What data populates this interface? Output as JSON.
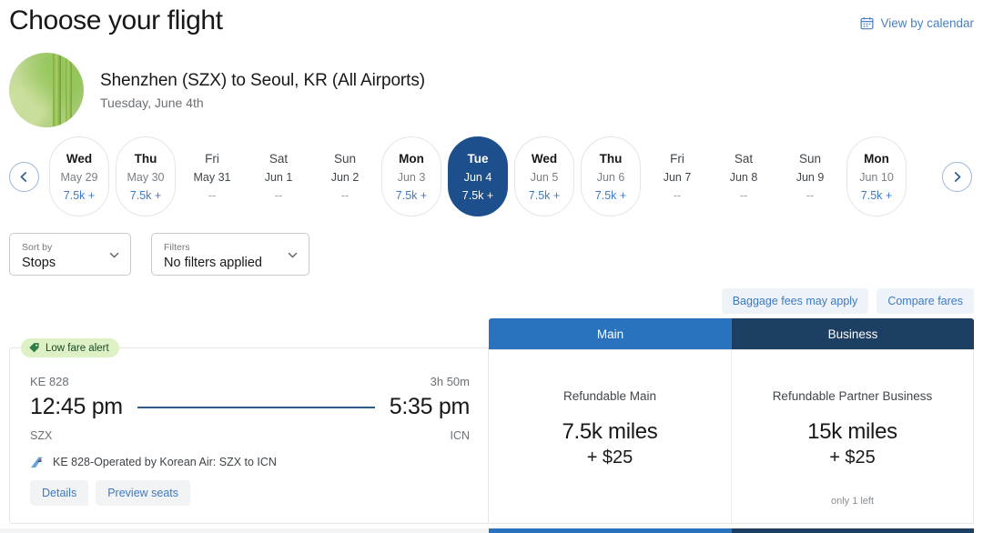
{
  "header": {
    "title": "Choose your flight",
    "view_by_calendar": "View by calendar",
    "calendar_icon": "calendar-icon"
  },
  "route": {
    "title": "Shenzhen (SZX) to Seoul, KR (All Airports)",
    "subtitle": "Tuesday, June 4th"
  },
  "carousel": {
    "prev_label": "chevron-left-icon",
    "next_label": "chevron-right-icon",
    "dates": [
      {
        "dow": "Wed",
        "date": "May 29",
        "price": "7.5k +",
        "state": "avail"
      },
      {
        "dow": "Thu",
        "date": "May 30",
        "price": "7.5k +",
        "state": "avail"
      },
      {
        "dow": "Fri",
        "date": "May 31",
        "price": "--",
        "state": "none"
      },
      {
        "dow": "Sat",
        "date": "Jun 1",
        "price": "--",
        "state": "none"
      },
      {
        "dow": "Sun",
        "date": "Jun 2",
        "price": "--",
        "state": "none"
      },
      {
        "dow": "Mon",
        "date": "Jun 3",
        "price": "7.5k +",
        "state": "avail"
      },
      {
        "dow": "Tue",
        "date": "Jun 4",
        "price": "7.5k +",
        "state": "selected"
      },
      {
        "dow": "Wed",
        "date": "Jun 5",
        "price": "7.5k +",
        "state": "avail"
      },
      {
        "dow": "Thu",
        "date": "Jun 6",
        "price": "7.5k +",
        "state": "avail"
      },
      {
        "dow": "Fri",
        "date": "Jun 7",
        "price": "--",
        "state": "none"
      },
      {
        "dow": "Sat",
        "date": "Jun 8",
        "price": "--",
        "state": "none"
      },
      {
        "dow": "Sun",
        "date": "Jun 9",
        "price": "--",
        "state": "none"
      },
      {
        "dow": "Mon",
        "date": "Jun 10",
        "price": "7.5k +",
        "state": "avail"
      }
    ]
  },
  "controls": {
    "sort": {
      "label": "Sort by",
      "value": "Stops"
    },
    "filters": {
      "label": "Filters",
      "value": "No filters applied"
    }
  },
  "fare_links": {
    "baggage": "Baggage fees may apply",
    "compare": "Compare fares"
  },
  "cabins": {
    "main": "Main",
    "business": "Business"
  },
  "flight": {
    "badge": "Low fare alert",
    "badge_icon": "tag-icon",
    "number": "KE 828",
    "duration": "3h 50m",
    "depart_time": "12:45 pm",
    "arrive_time": "5:35 pm",
    "depart_airport": "SZX",
    "arrive_airport": "ICN",
    "operator_icon": "airline-tail-icon",
    "operator": "KE 828-Operated by Korean Air: SZX to ICN",
    "details_button": "Details",
    "preview_seats_button": "Preview seats"
  },
  "fares": [
    {
      "name": "Refundable Main",
      "miles": "7.5k miles",
      "cash": "+ $25",
      "seats_left": ""
    },
    {
      "name": "Refundable Partner Business",
      "miles": "15k miles",
      "cash": "+ $25",
      "seats_left": "only 1 left"
    }
  ],
  "colors": {
    "main_accent": "#2a72bd",
    "business_accent": "#1d3f63",
    "selected_date": "#1d4f8c",
    "link": "#3d7ac4",
    "low_fare_bg": "#ddf1c4"
  }
}
